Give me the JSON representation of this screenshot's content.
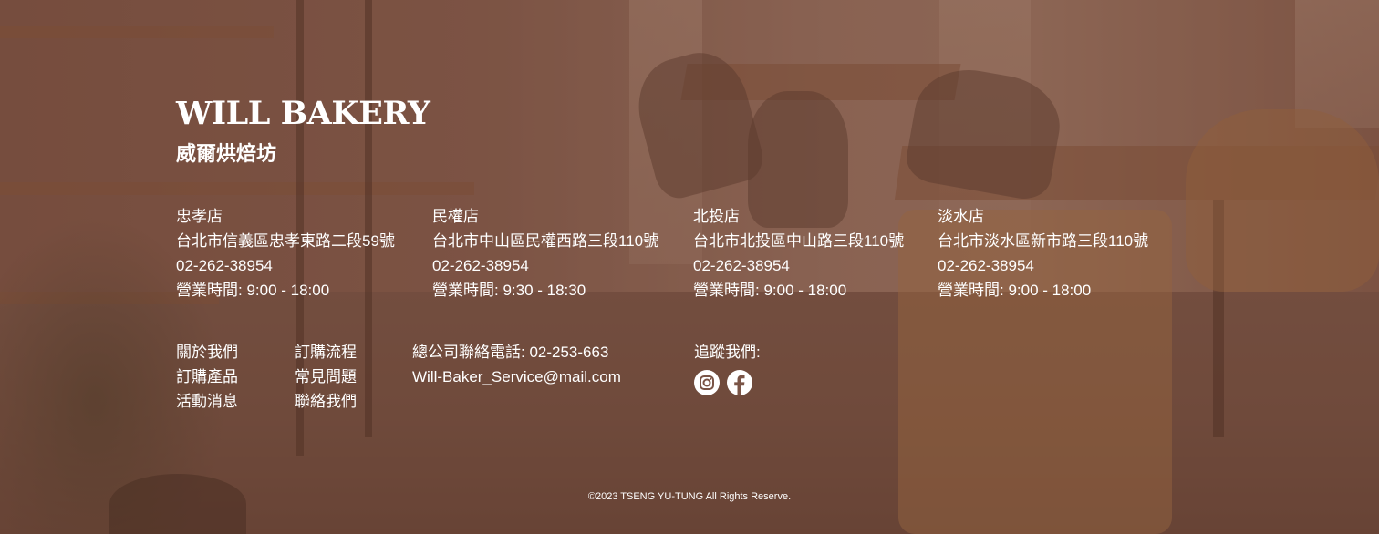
{
  "brand": {
    "name": "WILL BAKERY",
    "subtitle": "威爾烘焙坊"
  },
  "stores": [
    {
      "name": "忠孝店",
      "address": "台北市信義區忠孝東路二段59號",
      "phone": "02-262-38954",
      "hours": "營業時間: 9:00 - 18:00"
    },
    {
      "name": "民權店",
      "address": "台北市中山區民權西路三段110號",
      "phone": "02-262-38954",
      "hours": "營業時間: 9:30 - 18:30"
    },
    {
      "name": "北投店",
      "address": "台北市北投區中山路三段110號",
      "phone": "02-262-38954",
      "hours": "營業時間: 9:00 - 18:00"
    },
    {
      "name": "淡水店",
      "address": "台北市淡水區新市路三段110號",
      "phone": "02-262-38954",
      "hours": "營業時間: 9:00 - 18:00"
    }
  ],
  "links": {
    "col1": [
      "關於我們",
      "訂購產品",
      "活動消息"
    ],
    "col2": [
      "訂購流程",
      "常見問題",
      "聯絡我們"
    ]
  },
  "contact": {
    "phone": "總公司聯絡電話: 02-253-663",
    "email": "Will-Baker_Service@mail.com"
  },
  "follow": {
    "label": "追蹤我們:",
    "icons": [
      "instagram-icon",
      "facebook-icon"
    ]
  },
  "copyright": "©2023 TSENG YU-TUNG All Rights Reserve.",
  "colors": {
    "overlay": "#7a5446",
    "text": "#ffffff"
  }
}
